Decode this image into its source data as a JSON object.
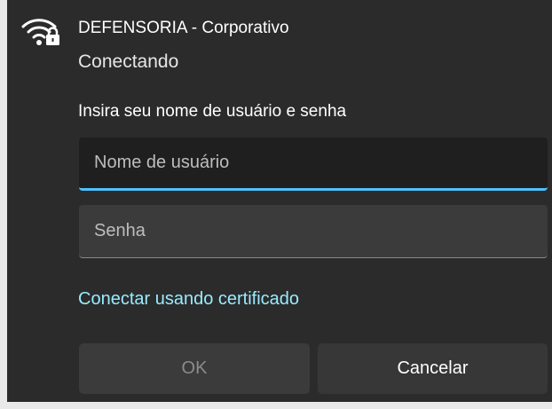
{
  "network": {
    "icon": "wifi-secured-icon",
    "name": "DEFENSORIA - Corporativo",
    "status": "Conectando"
  },
  "form": {
    "instruction": "Insira seu nome de usuário e senha",
    "username": {
      "placeholder": "Nome de usuário",
      "value": ""
    },
    "password": {
      "placeholder": "Senha",
      "value": ""
    },
    "certificate_link": "Conectar usando certificado"
  },
  "buttons": {
    "ok_label": "OK",
    "cancel_label": "Cancelar"
  },
  "colors": {
    "background": "#2b2b2b",
    "accent": "#4cc2ff",
    "link": "#99ebff"
  }
}
